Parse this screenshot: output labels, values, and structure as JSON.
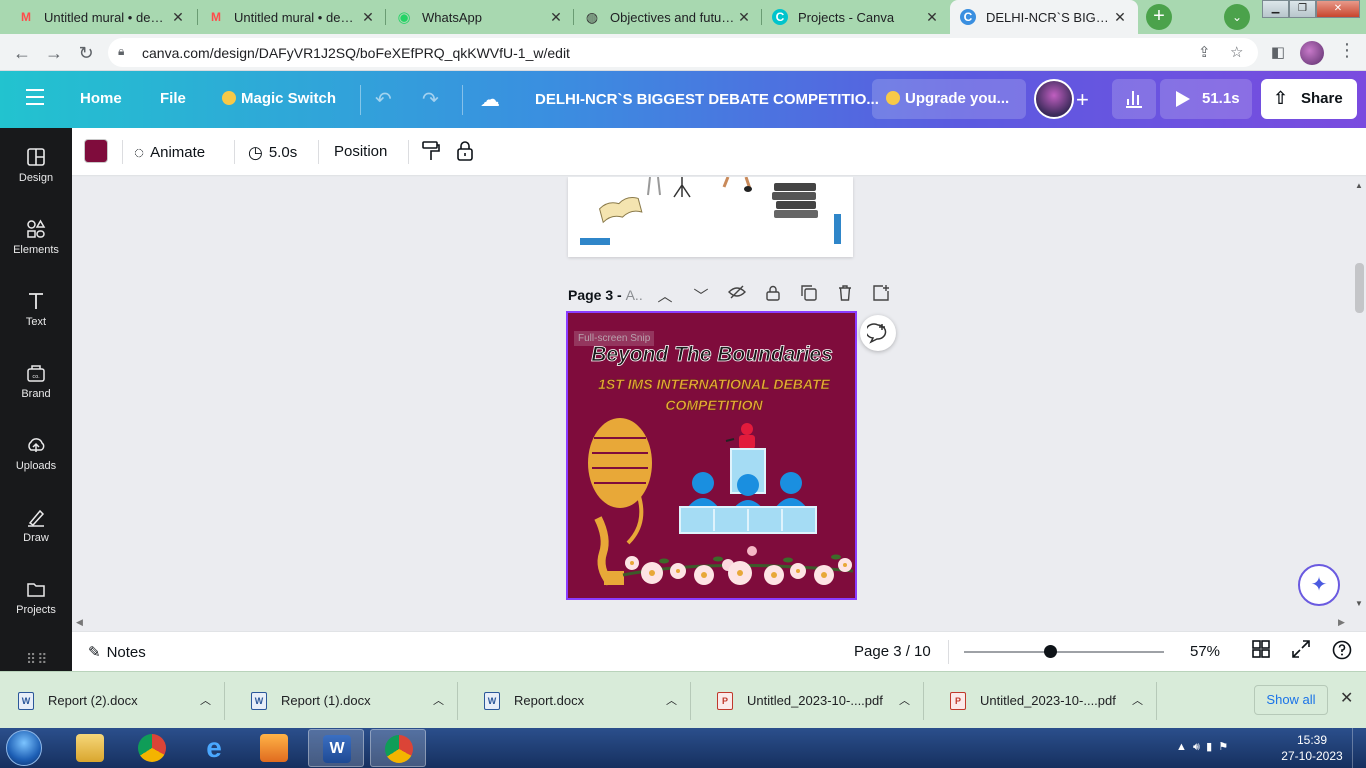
{
  "browser": {
    "tabs": [
      {
        "title": "Untitled mural • debate",
        "icon": "mural-icon",
        "active": false
      },
      {
        "title": "Untitled mural • debate",
        "icon": "mural-icon",
        "active": false
      },
      {
        "title": "WhatsApp",
        "icon": "whatsapp-icon",
        "active": false
      },
      {
        "title": "Objectives and future p",
        "icon": "globe-icon",
        "active": false
      },
      {
        "title": "Projects - Canva",
        "icon": "canva-icon",
        "active": false
      },
      {
        "title": "DELHI-NCR`S BIGGEST",
        "icon": "canva-icon",
        "active": true
      }
    ],
    "url": "canva.com/design/DAFyVR1J2SQ/boFeXEfPRQ_qkKWVfU-1_w/edit"
  },
  "header": {
    "home": "Home",
    "file": "File",
    "magic_switch": "Magic Switch",
    "title": "DELHI-NCR`S BIGGEST DEBATE COMPETITIO...",
    "upgrade": "Upgrade you...",
    "present_time": "51.1s",
    "share": "Share"
  },
  "sidebar": {
    "items": [
      {
        "label": "Design",
        "icon": "layout-icon"
      },
      {
        "label": "Elements",
        "icon": "shapes-icon"
      },
      {
        "label": "Text",
        "icon": "text-icon"
      },
      {
        "label": "Brand",
        "icon": "brand-icon"
      },
      {
        "label": "Uploads",
        "icon": "upload-icon"
      },
      {
        "label": "Draw",
        "icon": "pen-icon"
      },
      {
        "label": "Projects",
        "icon": "folder-icon"
      }
    ]
  },
  "toolbar": {
    "color": "#7f0c3c",
    "animate": "Animate",
    "duration": "5.0s",
    "position": "Position"
  },
  "canvas": {
    "page_label": "Page 3 -",
    "page_label_sub": "A..",
    "snip_text": "Full-screen Snip",
    "design": {
      "heading": "Beyond The Boundaries",
      "subheading_line1": "1ST IMS INTERNATIONAL DEBATE",
      "subheading_line2": "COMPETITION",
      "background": "#7f0c3c",
      "accent": "#e8a838"
    }
  },
  "footer": {
    "notes": "Notes",
    "page_count": "Page 3 / 10",
    "zoom": "57%",
    "zoom_level": 0.43
  },
  "downloads": {
    "items": [
      {
        "name": "Report (2).docx",
        "type": "docx"
      },
      {
        "name": "Report (1).docx",
        "type": "docx"
      },
      {
        "name": "Report.docx",
        "type": "docx"
      },
      {
        "name": "Untitled_2023-10-....pdf",
        "type": "pdf"
      },
      {
        "name": "Untitled_2023-10-....pdf",
        "type": "pdf"
      }
    ],
    "show_all": "Show all"
  },
  "taskbar": {
    "time": "15:39",
    "date": "27-10-2023"
  }
}
